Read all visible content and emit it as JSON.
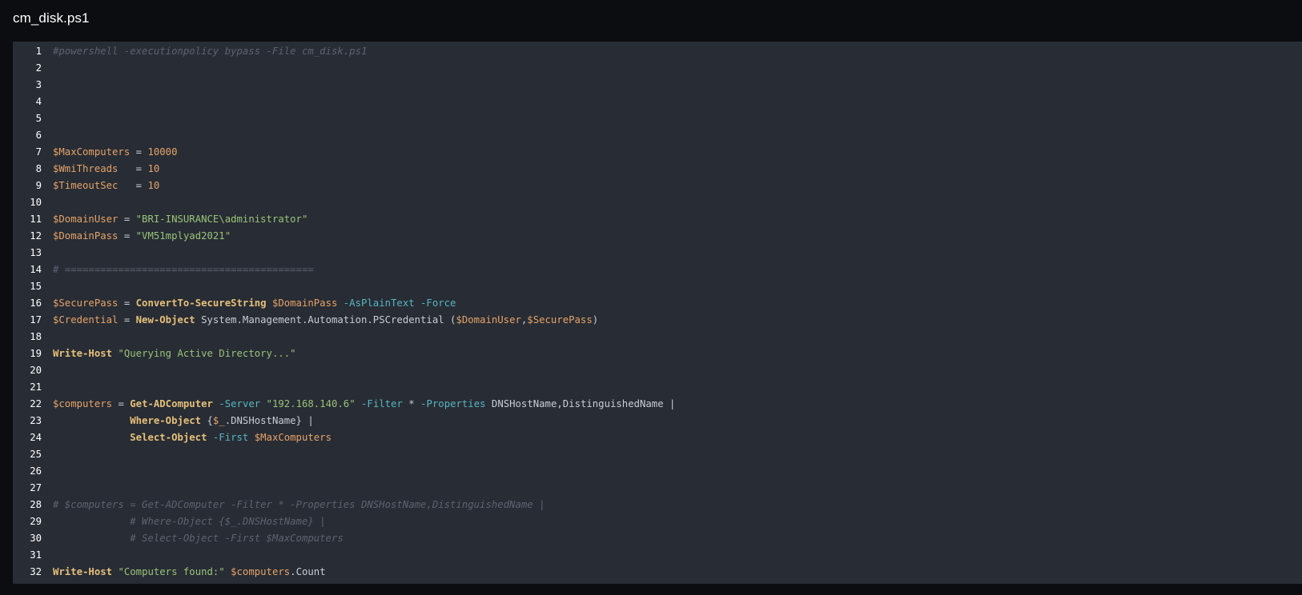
{
  "file": {
    "name": "cm_disk.ps1"
  },
  "colors": {
    "page_background": "#0c0d10",
    "code_background": "#282c34",
    "comment": "#5c6370",
    "variable": "#e5a46a",
    "number": "#e5a46a",
    "string": "#98c379",
    "command": "#e5c07b",
    "parameter": "#56b6c2",
    "text": "#c8ccd4"
  },
  "lines": [
    {
      "number": "1",
      "tokens": [
        {
          "t": "comment",
          "v": "#powershell -executionpolicy bypass -File cm_disk.ps1"
        }
      ]
    },
    {
      "number": "2",
      "tokens": []
    },
    {
      "number": "3",
      "tokens": []
    },
    {
      "number": "4",
      "tokens": []
    },
    {
      "number": "5",
      "tokens": []
    },
    {
      "number": "6",
      "tokens": []
    },
    {
      "number": "7",
      "tokens": [
        {
          "t": "var",
          "v": "$MaxComputers"
        },
        {
          "t": "op",
          "v": " = "
        },
        {
          "t": "number",
          "v": "10000"
        }
      ]
    },
    {
      "number": "8",
      "tokens": [
        {
          "t": "var",
          "v": "$WmiThreads"
        },
        {
          "t": "op",
          "v": "   = "
        },
        {
          "t": "number",
          "v": "10"
        }
      ]
    },
    {
      "number": "9",
      "tokens": [
        {
          "t": "var",
          "v": "$TimeoutSec"
        },
        {
          "t": "op",
          "v": "   = "
        },
        {
          "t": "number",
          "v": "10"
        }
      ]
    },
    {
      "number": "10",
      "tokens": []
    },
    {
      "number": "11",
      "tokens": [
        {
          "t": "var",
          "v": "$DomainUser"
        },
        {
          "t": "op",
          "v": " = "
        },
        {
          "t": "string",
          "v": "\"BRI-INSURANCE\\administrator\""
        }
      ]
    },
    {
      "number": "12",
      "tokens": [
        {
          "t": "var",
          "v": "$DomainPass"
        },
        {
          "t": "op",
          "v": " = "
        },
        {
          "t": "string",
          "v": "\"VM51mplyad2021\""
        }
      ]
    },
    {
      "number": "13",
      "tokens": []
    },
    {
      "number": "14",
      "tokens": [
        {
          "t": "comment",
          "v": "# =========================================="
        }
      ]
    },
    {
      "number": "15",
      "tokens": []
    },
    {
      "number": "16",
      "tokens": [
        {
          "t": "var",
          "v": "$SecurePass"
        },
        {
          "t": "op",
          "v": " = "
        },
        {
          "t": "cmd",
          "v": "ConvertTo-SecureString"
        },
        {
          "t": "text",
          "v": " "
        },
        {
          "t": "var",
          "v": "$DomainPass"
        },
        {
          "t": "text",
          "v": " "
        },
        {
          "t": "param",
          "v": "-AsPlainText"
        },
        {
          "t": "text",
          "v": " "
        },
        {
          "t": "param",
          "v": "-Force"
        }
      ]
    },
    {
      "number": "17",
      "tokens": [
        {
          "t": "var",
          "v": "$Credential"
        },
        {
          "t": "op",
          "v": " = "
        },
        {
          "t": "cmd",
          "v": "New-Object"
        },
        {
          "t": "text",
          "v": " System.Management.Automation.PSCredential ("
        },
        {
          "t": "var",
          "v": "$DomainUser"
        },
        {
          "t": "text",
          "v": ","
        },
        {
          "t": "var",
          "v": "$SecurePass"
        },
        {
          "t": "text",
          "v": ")"
        }
      ]
    },
    {
      "number": "18",
      "tokens": []
    },
    {
      "number": "19",
      "tokens": [
        {
          "t": "cmd",
          "v": "Write-Host"
        },
        {
          "t": "text",
          "v": " "
        },
        {
          "t": "string",
          "v": "\"Querying Active Directory...\""
        }
      ]
    },
    {
      "number": "20",
      "tokens": []
    },
    {
      "number": "21",
      "tokens": []
    },
    {
      "number": "22",
      "tokens": [
        {
          "t": "var",
          "v": "$computers"
        },
        {
          "t": "op",
          "v": " = "
        },
        {
          "t": "cmd",
          "v": "Get-ADComputer"
        },
        {
          "t": "text",
          "v": " "
        },
        {
          "t": "param",
          "v": "-Server"
        },
        {
          "t": "text",
          "v": " "
        },
        {
          "t": "string",
          "v": "\"192.168.140.6\""
        },
        {
          "t": "text",
          "v": " "
        },
        {
          "t": "param",
          "v": "-Filter"
        },
        {
          "t": "text",
          "v": " * "
        },
        {
          "t": "param",
          "v": "-Properties"
        },
        {
          "t": "text",
          "v": " DNSHostName,DistinguishedName |"
        }
      ]
    },
    {
      "number": "23",
      "tokens": [
        {
          "t": "text",
          "v": "             "
        },
        {
          "t": "cmd",
          "v": "Where-Object"
        },
        {
          "t": "text",
          "v": " {"
        },
        {
          "t": "var",
          "v": "$_"
        },
        {
          "t": "text",
          "v": ".DNSHostName} |"
        }
      ]
    },
    {
      "number": "24",
      "tokens": [
        {
          "t": "text",
          "v": "             "
        },
        {
          "t": "cmd",
          "v": "Select-Object"
        },
        {
          "t": "text",
          "v": " "
        },
        {
          "t": "param",
          "v": "-First"
        },
        {
          "t": "text",
          "v": " "
        },
        {
          "t": "var",
          "v": "$MaxComputers"
        }
      ]
    },
    {
      "number": "25",
      "tokens": []
    },
    {
      "number": "26",
      "tokens": []
    },
    {
      "number": "27",
      "tokens": []
    },
    {
      "number": "28",
      "tokens": [
        {
          "t": "comment",
          "v": "# $computers = Get-ADComputer -Filter * -Properties DNSHostName,DistinguishedName |"
        }
      ]
    },
    {
      "number": "29",
      "tokens": [
        {
          "t": "text",
          "v": "             "
        },
        {
          "t": "comment",
          "v": "# Where-Object {$_.DNSHostName} |"
        }
      ]
    },
    {
      "number": "30",
      "tokens": [
        {
          "t": "text",
          "v": "             "
        },
        {
          "t": "comment",
          "v": "# Select-Object -First $MaxComputers"
        }
      ]
    },
    {
      "number": "31",
      "tokens": []
    },
    {
      "number": "32",
      "tokens": [
        {
          "t": "cmd",
          "v": "Write-Host"
        },
        {
          "t": "text",
          "v": " "
        },
        {
          "t": "string",
          "v": "\"Computers found:\""
        },
        {
          "t": "text",
          "v": " "
        },
        {
          "t": "var",
          "v": "$computers"
        },
        {
          "t": "text",
          "v": ".Count"
        }
      ]
    }
  ]
}
